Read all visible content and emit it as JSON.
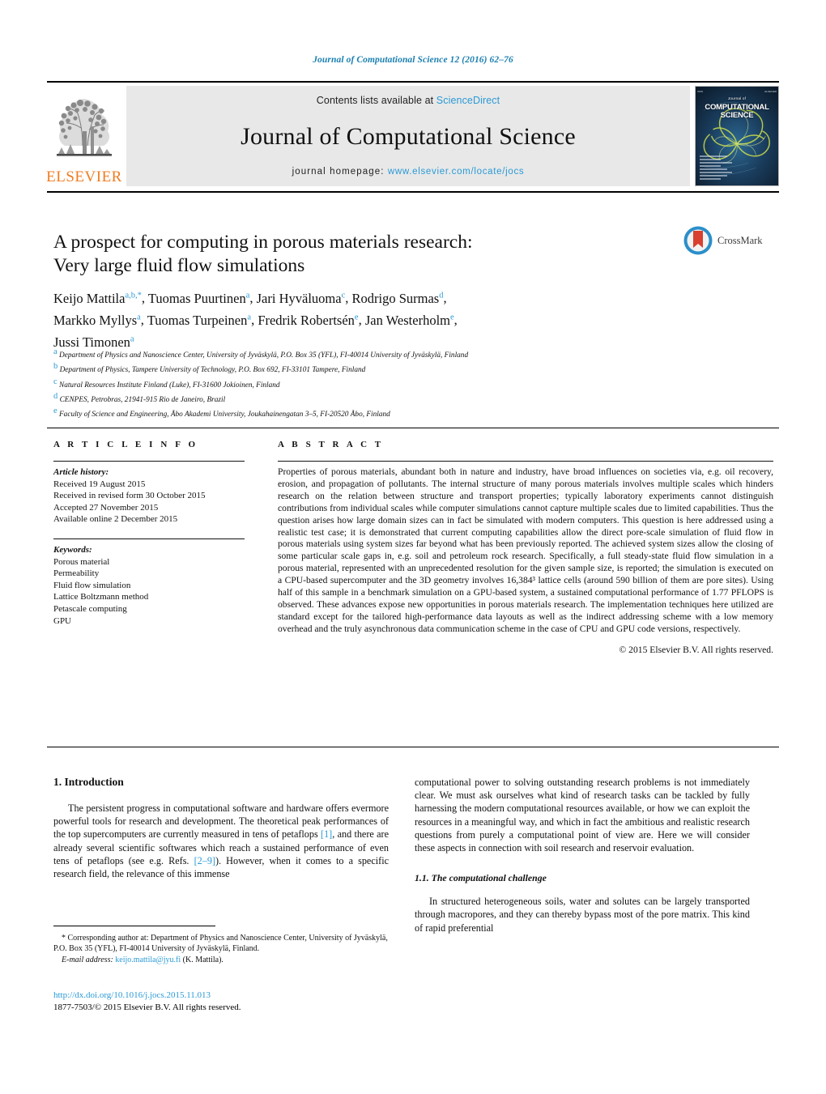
{
  "running_head": "Journal of Computational Science 12 (2016) 62–76",
  "masthead": {
    "contents_prefix": "Contents lists available at ",
    "sciencedirect": "ScienceDirect",
    "journal_name": "Journal of Computational Science",
    "homepage_prefix": "journal homepage: ",
    "homepage_url": "www.elsevier.com/locate/jocs",
    "publisher": "ELSEVIER",
    "cover": {
      "kicker": "Journal of",
      "line1": "COMPUTATIONAL",
      "line2": "SCIENCE"
    },
    "link_color": "#2a9ad6",
    "banner_bg": "#e8e8e8",
    "elsevier_orange": "#f07c22"
  },
  "crossmark": {
    "label": "CrossMark",
    "ring_color": "#2b8fc9",
    "bookmark_color": "#d8402f"
  },
  "article": {
    "title_line1": "A prospect for computing in porous materials research:",
    "title_line2": "Very large fluid flow simulations",
    "authors": [
      {
        "name": "Keijo Mattila",
        "marks": "a,b,",
        "star": true
      },
      {
        "name": "Tuomas Puurtinen",
        "marks": "a"
      },
      {
        "name": "Jari Hyväluoma",
        "marks": "c"
      },
      {
        "name": "Rodrigo Surmas",
        "marks": "d"
      },
      {
        "name": "Markko Myllys",
        "marks": "a"
      },
      {
        "name": "Tuomas Turpeinen",
        "marks": "a"
      },
      {
        "name": "Fredrik Robertsén",
        "marks": "e"
      },
      {
        "name": "Jan Westerholm",
        "marks": "e"
      },
      {
        "name": "Jussi Timonen",
        "marks": "a"
      }
    ],
    "affiliations": [
      {
        "mark": "a",
        "text": "Department of Physics and Nanoscience Center, University of Jyväskylä, P.O. Box 35 (YFL), FI-40014 University of Jyväskylä, Finland"
      },
      {
        "mark": "b",
        "text": "Department of Physics, Tampere University of Technology, P.O. Box 692, FI-33101 Tampere, Finland"
      },
      {
        "mark": "c",
        "text": "Natural Resources Institute Finland (Luke), FI-31600 Jokioinen, Finland"
      },
      {
        "mark": "d",
        "text": "CENPES, Petrobras, 21941-915 Rio de Janeiro, Brazil"
      },
      {
        "mark": "e",
        "text": "Faculty of Science and Engineering, Åbo Akademi University, Joukahainengatan 3–5, FI-20520 Åbo, Finland"
      }
    ]
  },
  "article_info": {
    "heading": "A R T I C L E   I N F O",
    "history_label": "Article history:",
    "history": [
      "Received 19 August 2015",
      "Received in revised form 30 October 2015",
      "Accepted 27 November 2015",
      "Available online 2 December 2015"
    ],
    "keywords_label": "Keywords:",
    "keywords": [
      "Porous material",
      "Permeability",
      "Fluid flow simulation",
      "Lattice Boltzmann method",
      "Petascale computing",
      "GPU"
    ]
  },
  "abstract": {
    "heading": "A B S T R A C T",
    "text": "Properties of porous materials, abundant both in nature and industry, have broad influences on societies via, e.g. oil recovery, erosion, and propagation of pollutants. The internal structure of many porous materials involves multiple scales which hinders research on the relation between structure and transport properties; typically laboratory experiments cannot distinguish contributions from individual scales while computer simulations cannot capture multiple scales due to limited capabilities. Thus the question arises how large domain sizes can in fact be simulated with modern computers. This question is here addressed using a realistic test case; it is demonstrated that current computing capabilities allow the direct pore-scale simulation of fluid flow in porous materials using system sizes far beyond what has been previously reported. The achieved system sizes allow the closing of some particular scale gaps in, e.g. soil and petroleum rock research. Specifically, a full steady-state fluid flow simulation in a porous material, represented with an unprecedented resolution for the given sample size, is reported; the simulation is executed on a CPU-based supercomputer and the 3D geometry involves 16,384³ lattice cells (around 590 billion of them are pore sites). Using half of this sample in a benchmark simulation on a GPU-based system, a sustained computational performance of 1.77 PFLOPS is observed. These advances expose new opportunities in porous materials research. The implementation techniques here utilized are standard except for the tailored high-performance data layouts as well as the indirect addressing scheme with a low memory overhead and the truly asynchronous data communication scheme in the case of CPU and GPU code versions, respectively.",
    "copyright": "© 2015 Elsevier B.V. All rights reserved."
  },
  "body": {
    "section1_heading": "1.  Introduction",
    "para1_a": "The persistent progress in computational software and hardware offers evermore powerful tools for research and development. The theoretical peak performances of the top supercomputers are currently measured in tens of petaflops ",
    "cite1": "[1]",
    "para1_b": ", and there are already several scientific softwares which reach a sustained performance of even tens of petaflops (see e.g. Refs. ",
    "cite2": "[2–9]",
    "para1_c": "). However, when it comes to a specific research field, the relevance of this immense computational power to solving outstanding research problems is not immediately clear. We must ask ourselves what kind of research tasks can be tackled by fully harnessing the modern computational resources available, or how we can exploit the resources in a meaningful way, and which in fact the ambitious and realistic research questions from purely a computational point of view are. Here we will consider these aspects in connection with soil research and reservoir evaluation.",
    "subsection_heading": "1.1.  The computational challenge",
    "para2": "In structured heterogeneous soils, water and solutes can be largely transported through macropores, and they can thereby bypass most of the pore matrix. This kind of rapid preferential"
  },
  "footnote": {
    "line1": "* Corresponding author at: Department of Physics and Nanoscience Center, University of Jyväskylä, P.O. Box 35 (YFL), FI-40014 University of Jyväskylä, Finland.",
    "email_label": "E-mail address:",
    "email": "keijo.mattila@jyu.fi",
    "email_suffix": " (K. Mattila)."
  },
  "footer": {
    "doi": "http://dx.doi.org/10.1016/j.jocs.2015.11.013",
    "issn_line": "1877-7503/© 2015 Elsevier B.V. All rights reserved."
  }
}
